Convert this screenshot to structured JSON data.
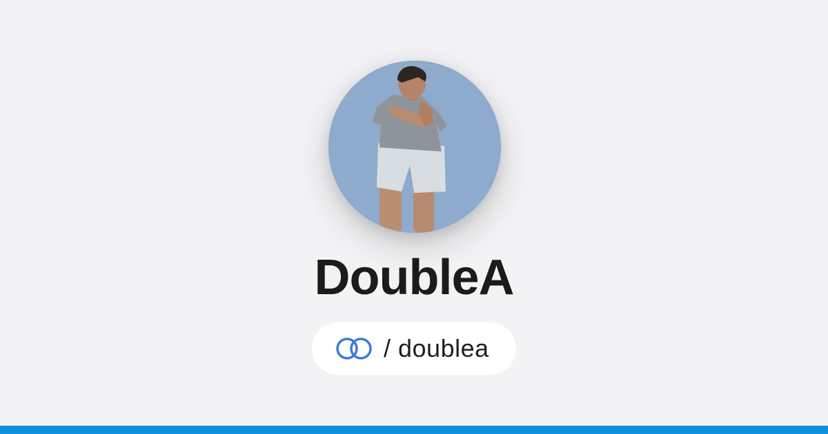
{
  "profile": {
    "display_name": "DoubleA",
    "handle": "/ doublea",
    "avatar_icon": "profile-photo"
  },
  "brand": {
    "icon": "linked-rings-icon",
    "accent_color": "#3d7bd8"
  },
  "footer": {
    "bar_color": "#0f90df"
  }
}
